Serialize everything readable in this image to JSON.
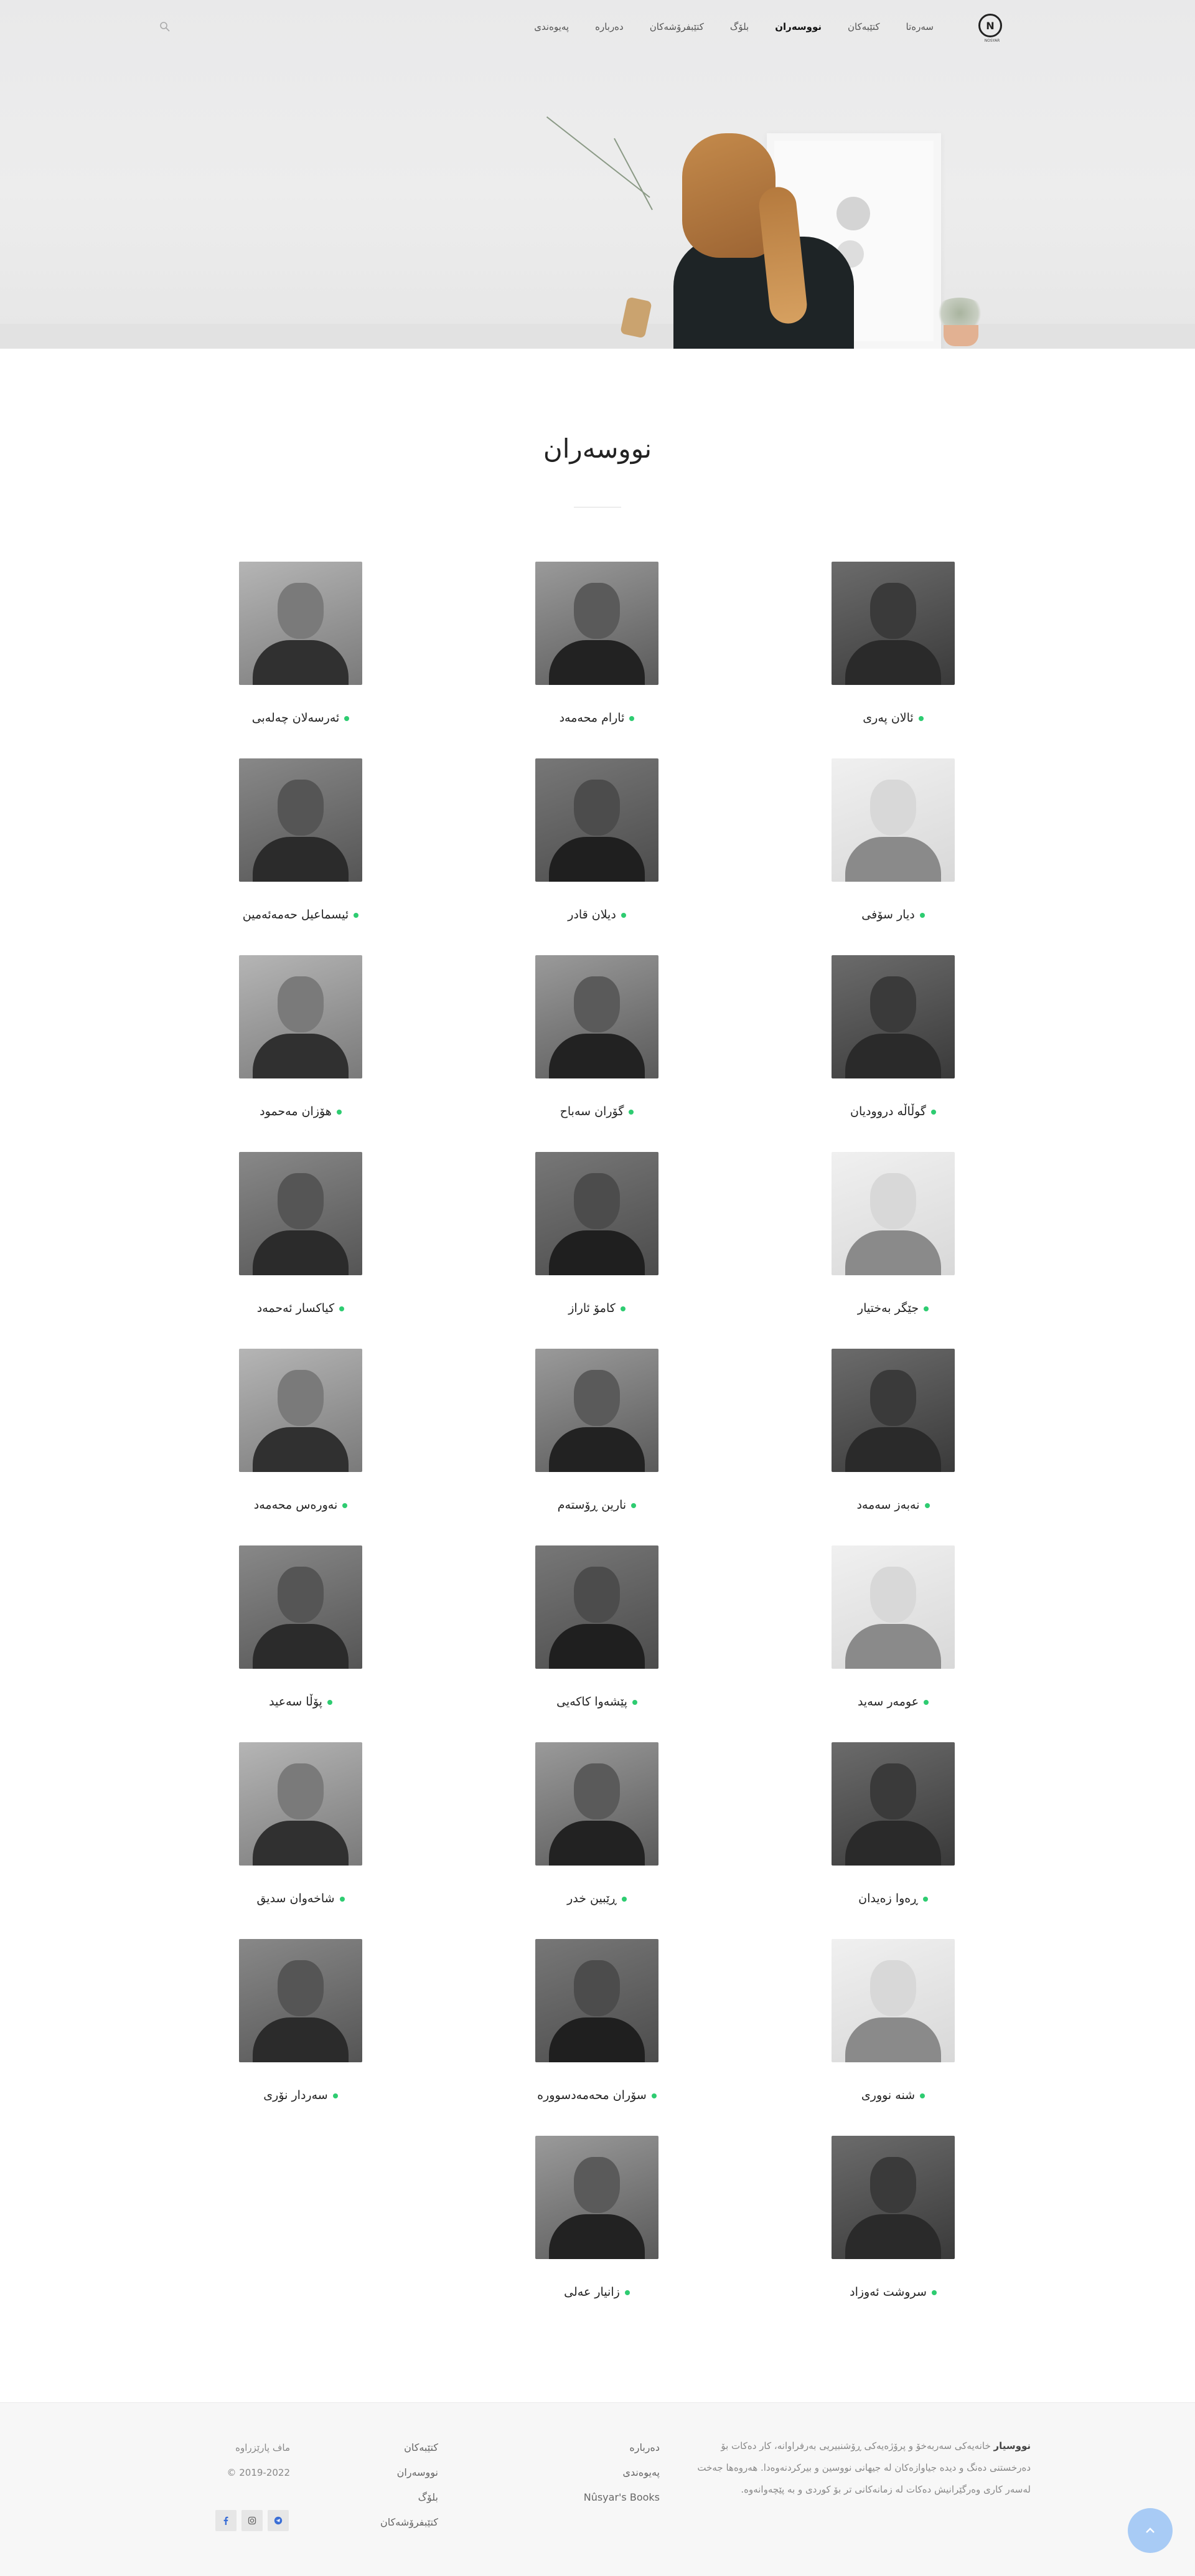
{
  "header": {
    "logo_glyph": "N",
    "logo_caption": "NOSYAR",
    "menu": [
      {
        "label": "سەرەتا",
        "active": false
      },
      {
        "label": "کتێبەکان",
        "active": false
      },
      {
        "label": "نووسەران",
        "active": true
      },
      {
        "label": "بلۆگ",
        "active": false
      },
      {
        "label": "کتێبفرۆشەکان",
        "active": false
      },
      {
        "label": "دەربارە",
        "active": false
      },
      {
        "label": "پەیوەندی",
        "active": false
      }
    ]
  },
  "page_title": "نووسەران",
  "writers": [
    {
      "name": "ئالان پەری"
    },
    {
      "name": "ئارام محەمەد"
    },
    {
      "name": "ئەرسەلان چەلەبی"
    },
    {
      "name": "دیار سۆفی"
    },
    {
      "name": "دیلان قادر"
    },
    {
      "name": "ئیسماعیل حەمەئەمین"
    },
    {
      "name": "گوڵاڵە درووديان"
    },
    {
      "name": "گۆران سەباح"
    },
    {
      "name": "هۆزان مەحمود"
    },
    {
      "name": "جێگر بەختیار"
    },
    {
      "name": "کامۆ ئاراز"
    },
    {
      "name": "کیاکسار ئەحمەد"
    },
    {
      "name": "نەبەز سەمەد"
    },
    {
      "name": "نارین ڕۆستەم"
    },
    {
      "name": "نەورەس محەمەد"
    },
    {
      "name": "عومەر سەید"
    },
    {
      "name": "پێشەوا کاکەیی"
    },
    {
      "name": "پۆڵا سەعید"
    },
    {
      "name": "ڕەوا زەیدان"
    },
    {
      "name": "ڕێبین خدر"
    },
    {
      "name": "شاخەوان سدیق"
    },
    {
      "name": "شنە نووری"
    },
    {
      "name": "سۆران محەمەدسوورە"
    },
    {
      "name": "سەردار نۆری"
    },
    {
      "name": "سروشت ئەوزاد"
    },
    {
      "name": "زانیار عەلی"
    }
  ],
  "footer": {
    "about_title": "نووسیار",
    "about_text": " خانەیەکی سەربەخۆ و پرۆژەیەکی ڕۆشنبیریی بەرفراوانە، کار دەکات بۆ دەرخستنی دەنگ و دیدە جیاوازەکان لە جیهانی نووسین و بیرکردنەوەدا. هەروەها جەخت لەسەر کاری وەرگێرانیش دەکات لە زمانەکانی تر بۆ کوردی و بە پێچەوانەوە.",
    "col1": [
      "دەربارە",
      "پەیوەندی",
      "Nûsyar's Books"
    ],
    "col2": [
      "کتێبەکان",
      "نووسەران",
      "بلۆگ",
      "کتێبفرۆشەکان"
    ],
    "copyright_1": "ماف پارێزراوە",
    "copyright_2": "© 2019-2022"
  }
}
